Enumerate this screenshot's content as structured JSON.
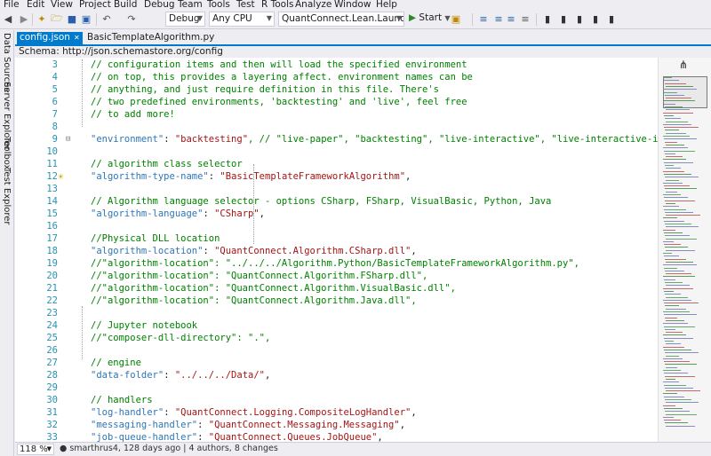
{
  "menu": [
    "File",
    "Edit",
    "View",
    "Project",
    "Build",
    "Debug",
    "Team",
    "Tools",
    "Test",
    "R Tools",
    "Analyze",
    "Window",
    "Help"
  ],
  "toolbar": {
    "config": "Debug",
    "platform": "Any CPU",
    "startup_project": "QuantConnect.Lean.Launcher",
    "start_label": "Start"
  },
  "left_tabs": [
    "Data Sources",
    "Server Explorer",
    "Toolbox",
    "Test Explorer"
  ],
  "doc_tabs": [
    {
      "label": "config.json",
      "active": true
    },
    {
      "label": "BasicTemplateAlgorithm.py",
      "active": false
    }
  ],
  "schema_bar": "Schema: http://json.schemastore.org/config",
  "lines": [
    {
      "n": "3",
      "t": "// configuration items and then will load the specified environment",
      "c": true
    },
    {
      "n": "4",
      "t": "// on top, this provides a layering affect. environment names can be",
      "c": true
    },
    {
      "n": "5",
      "t": "// anything, and just require definition in this file. There's",
      "c": true
    },
    {
      "n": "6",
      "t": "// two predefined environments, 'backtesting' and 'live', feel free",
      "c": true
    },
    {
      "n": "7",
      "t": "// to add more!",
      "c": true
    },
    {
      "n": "8",
      "t": "",
      "c": false
    },
    {
      "n": "9",
      "k": "\"environment\"",
      "s": "\"backtesting\"",
      "r": ", // \"live-paper\", \"backtesting\", \"live-interactive\", \"live-interactive-iqfeed\"",
      "fold": true
    },
    {
      "n": "10",
      "t": "",
      "c": false
    },
    {
      "n": "11",
      "t": "// algorithm class selector",
      "c": true
    },
    {
      "n": "12",
      "k": "\"algorithm-type-name\"",
      "s": "\"BasicTemplateFrameworkAlgorithm\"",
      "r": ",",
      "bulb": true
    },
    {
      "n": "13",
      "t": "",
      "c": false
    },
    {
      "n": "14",
      "t": "// Algorithm language selector - options CSharp, FSharp, VisualBasic, Python, Java",
      "c": true
    },
    {
      "n": "15",
      "k": "\"algorithm-language\"",
      "s": "\"CSharp\"",
      "r": ","
    },
    {
      "n": "16",
      "t": "",
      "c": false
    },
    {
      "n": "17",
      "t": "//Physical DLL location",
      "c": true
    },
    {
      "n": "18",
      "k": "\"algorithm-location\"",
      "s": "\"QuantConnect.Algorithm.CSharp.dll\"",
      "r": ","
    },
    {
      "n": "19",
      "t": "//\"algorithm-location\": \"../../../Algorithm.Python/BasicTemplateFrameworkAlgorithm.py\",",
      "c": true
    },
    {
      "n": "20",
      "t": "//\"algorithm-location\": \"QuantConnect.Algorithm.FSharp.dll\",",
      "c": true
    },
    {
      "n": "21",
      "t": "//\"algorithm-location\": \"QuantConnect.Algorithm.VisualBasic.dll\",",
      "c": true
    },
    {
      "n": "22",
      "t": "//\"algorithm-location\": \"QuantConnect.Algorithm.Java.dll\",",
      "c": true
    },
    {
      "n": "23",
      "t": "",
      "c": false
    },
    {
      "n": "24",
      "t": "// Jupyter notebook",
      "c": true
    },
    {
      "n": "25",
      "t": "//\"composer-dll-directory\": \".\",",
      "c": true
    },
    {
      "n": "26",
      "t": "",
      "c": false
    },
    {
      "n": "27",
      "t": "// engine",
      "c": true
    },
    {
      "n": "28",
      "k": "\"data-folder\"",
      "s": "\"../../../Data/\"",
      "r": ","
    },
    {
      "n": "29",
      "t": "",
      "c": false
    },
    {
      "n": "30",
      "t": "// handlers",
      "c": true
    },
    {
      "n": "31",
      "k": "\"log-handler\"",
      "s": "\"QuantConnect.Logging.CompositeLogHandler\"",
      "r": ","
    },
    {
      "n": "32",
      "k": "\"messaging-handler\"",
      "s": "\"QuantConnect.Messaging.Messaging\"",
      "r": ","
    },
    {
      "n": "33",
      "k": "\"job-queue-handler\"",
      "s": "\"QuantConnect.Queues.JobQueue\"",
      "r": ","
    }
  ],
  "status": {
    "zoom": "118 %",
    "git": "smarthrus4, 128 days ago | 4 authors, 8 changes"
  }
}
